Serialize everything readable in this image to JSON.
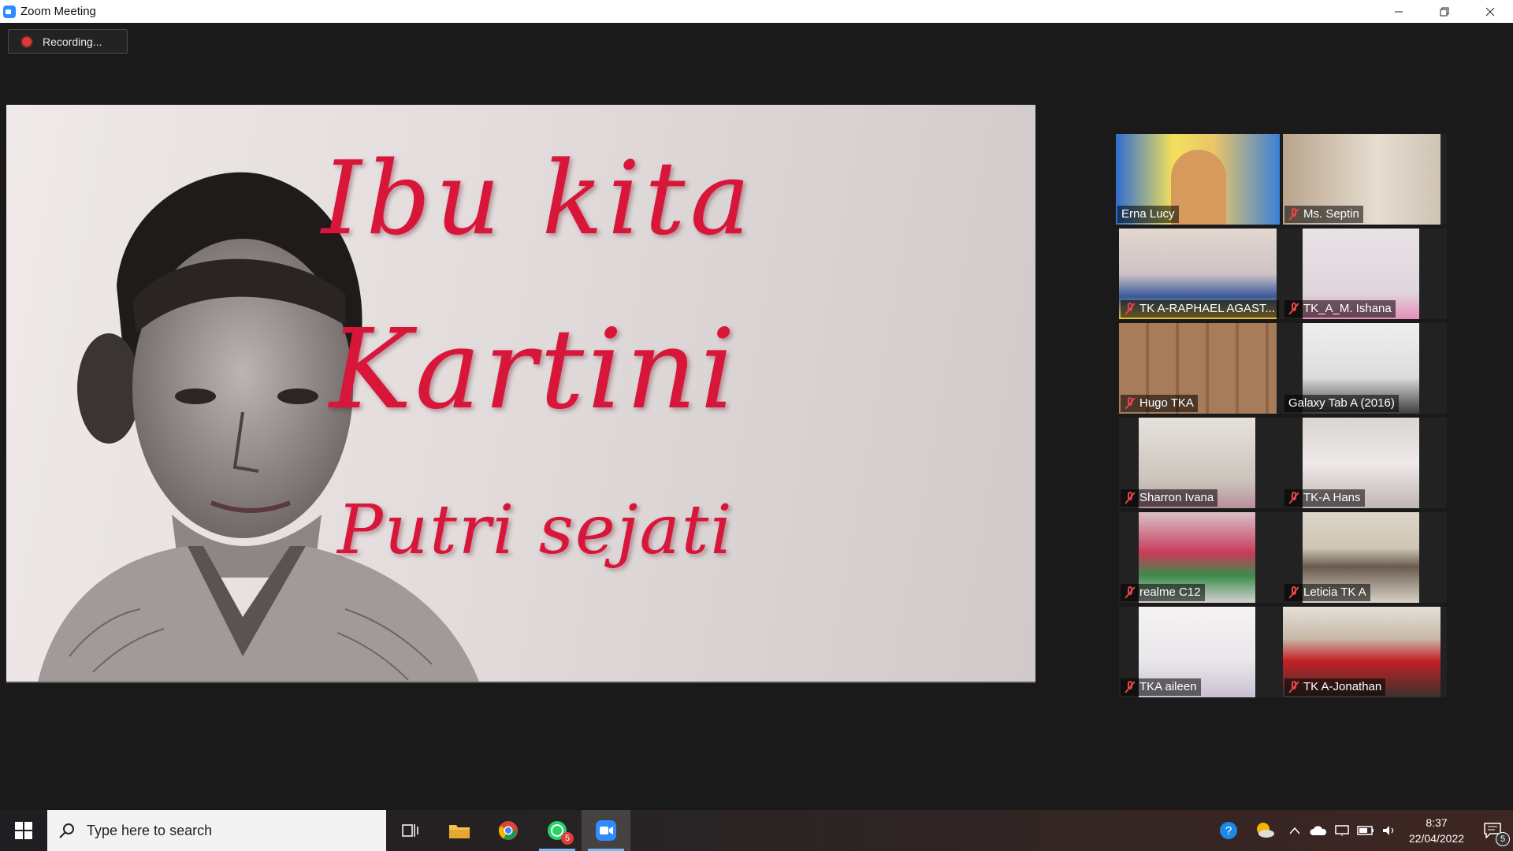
{
  "window": {
    "title": "Zoom Meeting"
  },
  "recording": {
    "label": "Recording..."
  },
  "share": {
    "line1": "Ibu kita",
    "line2": "Kartini",
    "line3": "Putri sejati"
  },
  "participants": [
    {
      "name": "Erna Lucy",
      "muted": false,
      "active": true
    },
    {
      "name": "Ms. Septin",
      "muted": true
    },
    {
      "name": "TK A-RAPHAEL AGAST...",
      "muted": true
    },
    {
      "name": "TK_A_M. Ishana",
      "muted": true
    },
    {
      "name": "Hugo TKA",
      "muted": true
    },
    {
      "name": "Galaxy Tab A (2016)",
      "muted": false
    },
    {
      "name": "Sharron Ivana",
      "muted": true
    },
    {
      "name": "TK-A Hans",
      "muted": true
    },
    {
      "name": "realme C12",
      "muted": true
    },
    {
      "name": "Leticia TK A",
      "muted": true
    },
    {
      "name": "TKA aileen",
      "muted": true
    },
    {
      "name": "TK A-Jonathan",
      "muted": true
    }
  ],
  "taskbar": {
    "search_placeholder": "Type here to search",
    "whatsapp_badge": "5",
    "time": "8:37",
    "date": "22/04/2022",
    "notification_count": "5"
  }
}
